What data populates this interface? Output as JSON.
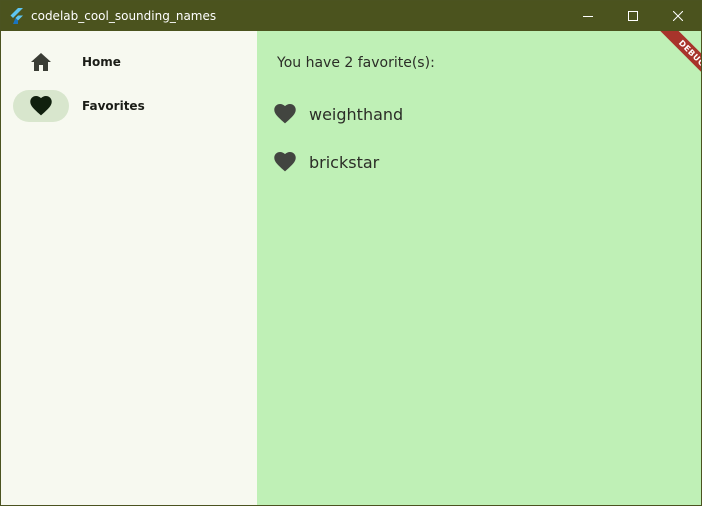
{
  "window": {
    "title": "codelab_cool_sounding_names",
    "titlebar_color": "#4b531e"
  },
  "sidebar": {
    "items": [
      {
        "label": "Home",
        "icon": "home-icon",
        "selected": false
      },
      {
        "label": "Favorites",
        "icon": "heart-icon",
        "selected": true
      }
    ]
  },
  "main": {
    "count_text": "You have 2 favorite(s):",
    "favorites": [
      "weighthand",
      "brickstar"
    ],
    "background_color": "#bff0b6"
  },
  "debug_banner": {
    "label": "DEBUG",
    "color": "#a8342b"
  }
}
